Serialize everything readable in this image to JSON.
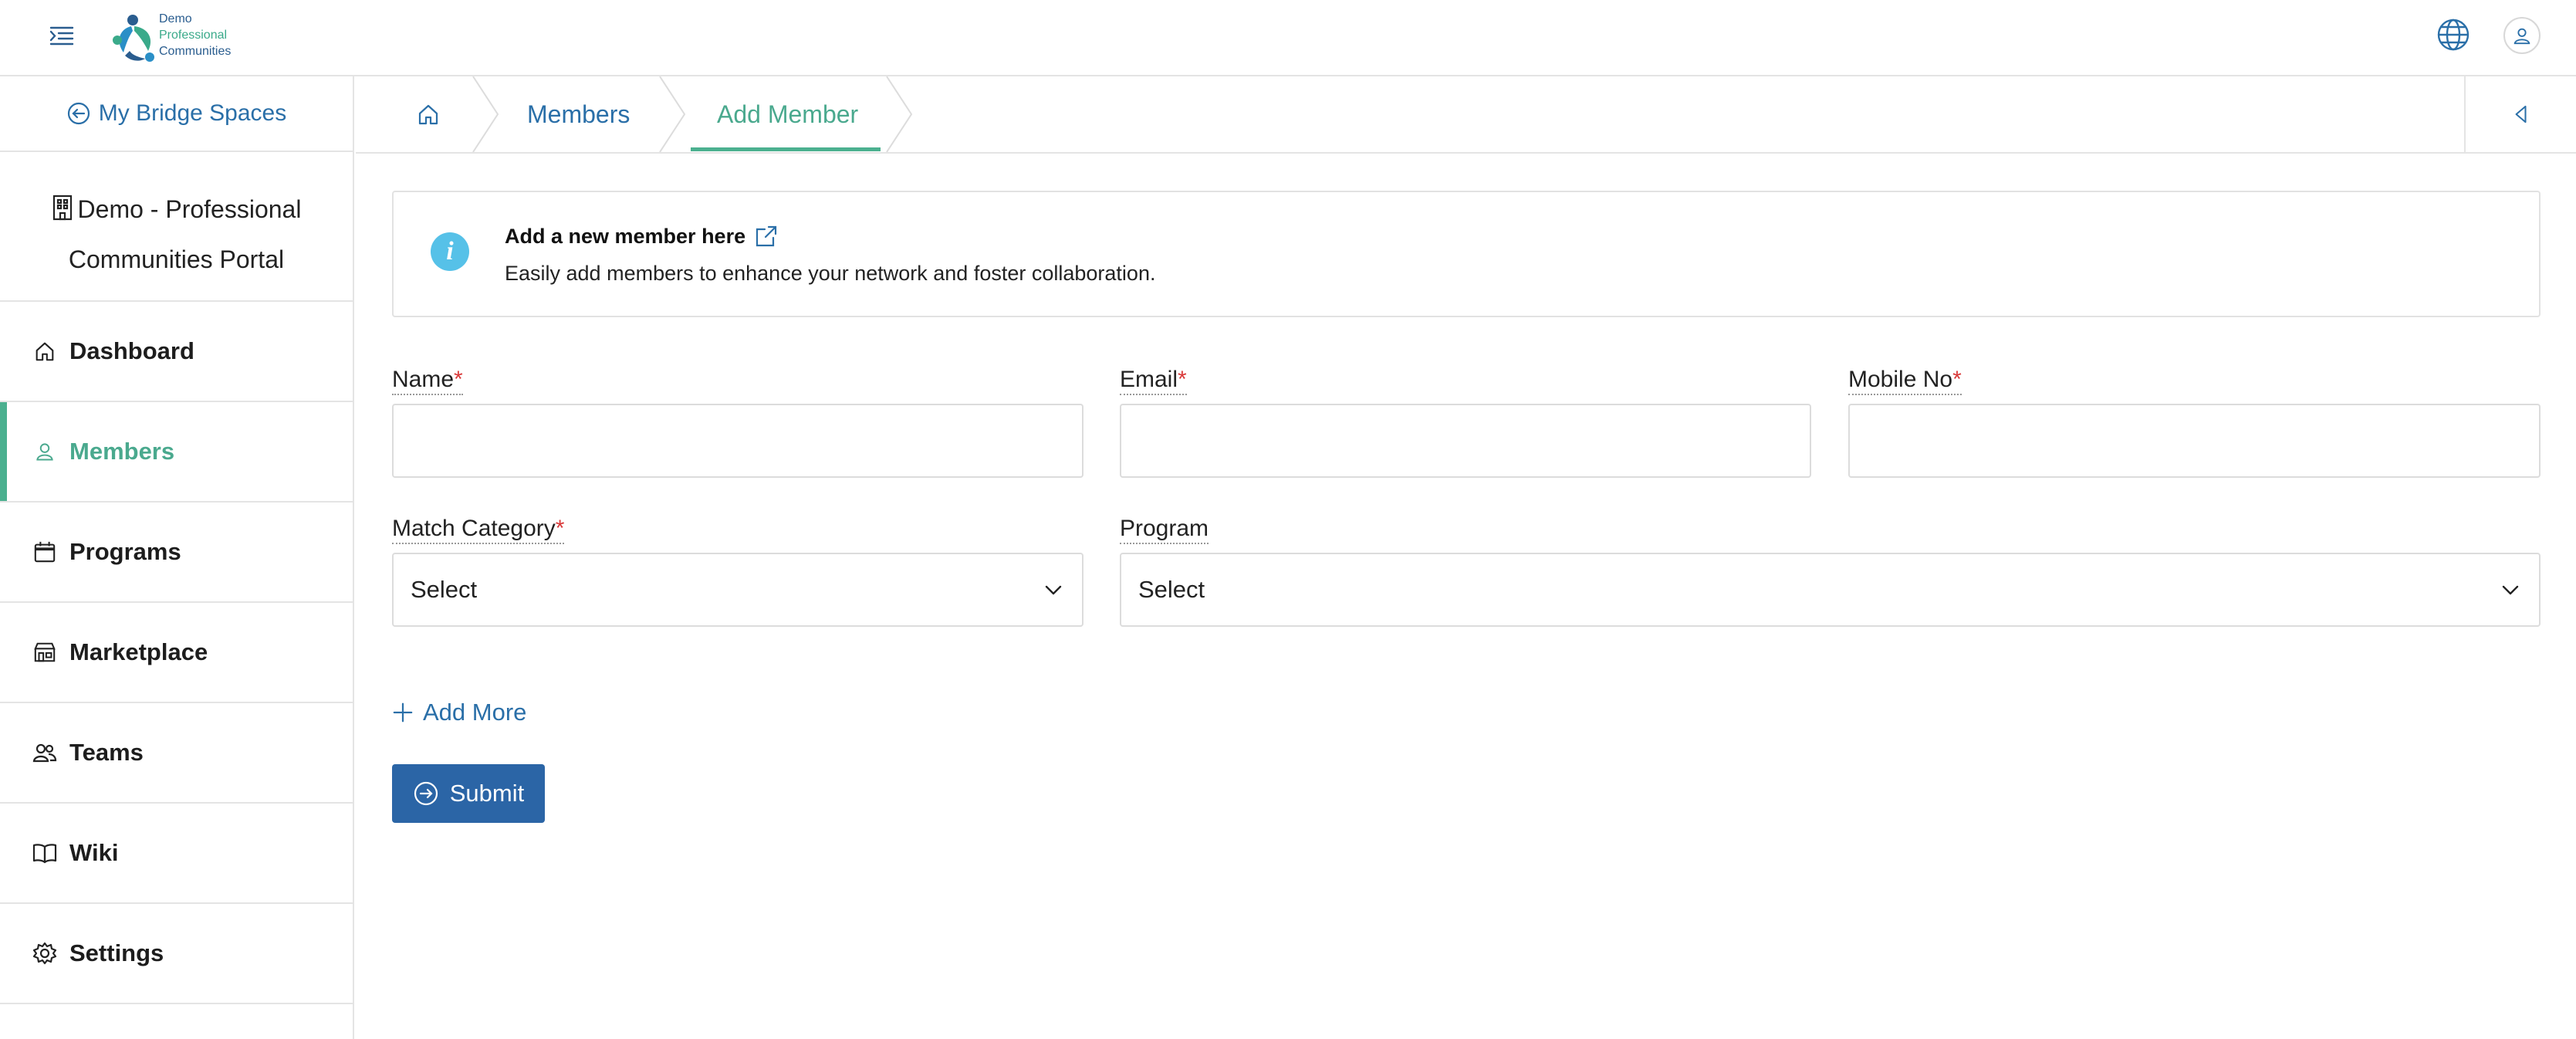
{
  "brand": {
    "logo_line1": "Demo",
    "logo_line2": "Professional",
    "logo_line3": "Communities",
    "accent_green": "#4bb08f",
    "accent_blue": "#2b65a6"
  },
  "header": {
    "menu_icon": "menu-indent-icon",
    "globe_icon": "globe-icon",
    "user_icon": "user-icon"
  },
  "sidebar": {
    "back_label": "My Bridge Spaces",
    "portal_name": "Demo - Professional Communities Portal",
    "items": [
      {
        "label": "Dashboard",
        "icon": "home-icon"
      },
      {
        "label": "Members",
        "icon": "person-icon",
        "active": true
      },
      {
        "label": "Programs",
        "icon": "calendar-icon"
      },
      {
        "label": "Marketplace",
        "icon": "store-icon"
      },
      {
        "label": "Teams",
        "icon": "people-icon"
      },
      {
        "label": "Wiki",
        "icon": "book-icon"
      },
      {
        "label": "Settings",
        "icon": "gear-icon"
      }
    ]
  },
  "breadcrumb": {
    "home_icon": "home-icon",
    "items": [
      "Members",
      "Add Member"
    ]
  },
  "info": {
    "title": "Add a new member here",
    "description": "Easily add members to enhance your network and foster collaboration."
  },
  "form": {
    "name_label": "Name",
    "email_label": "Email",
    "mobile_label": "Mobile No",
    "required_mark": "*",
    "match_category_label": "Match Category",
    "match_category_value": "Select",
    "program_label": "Program",
    "program_value": "Select",
    "add_more_label": "Add More",
    "submit_label": "Submit"
  }
}
